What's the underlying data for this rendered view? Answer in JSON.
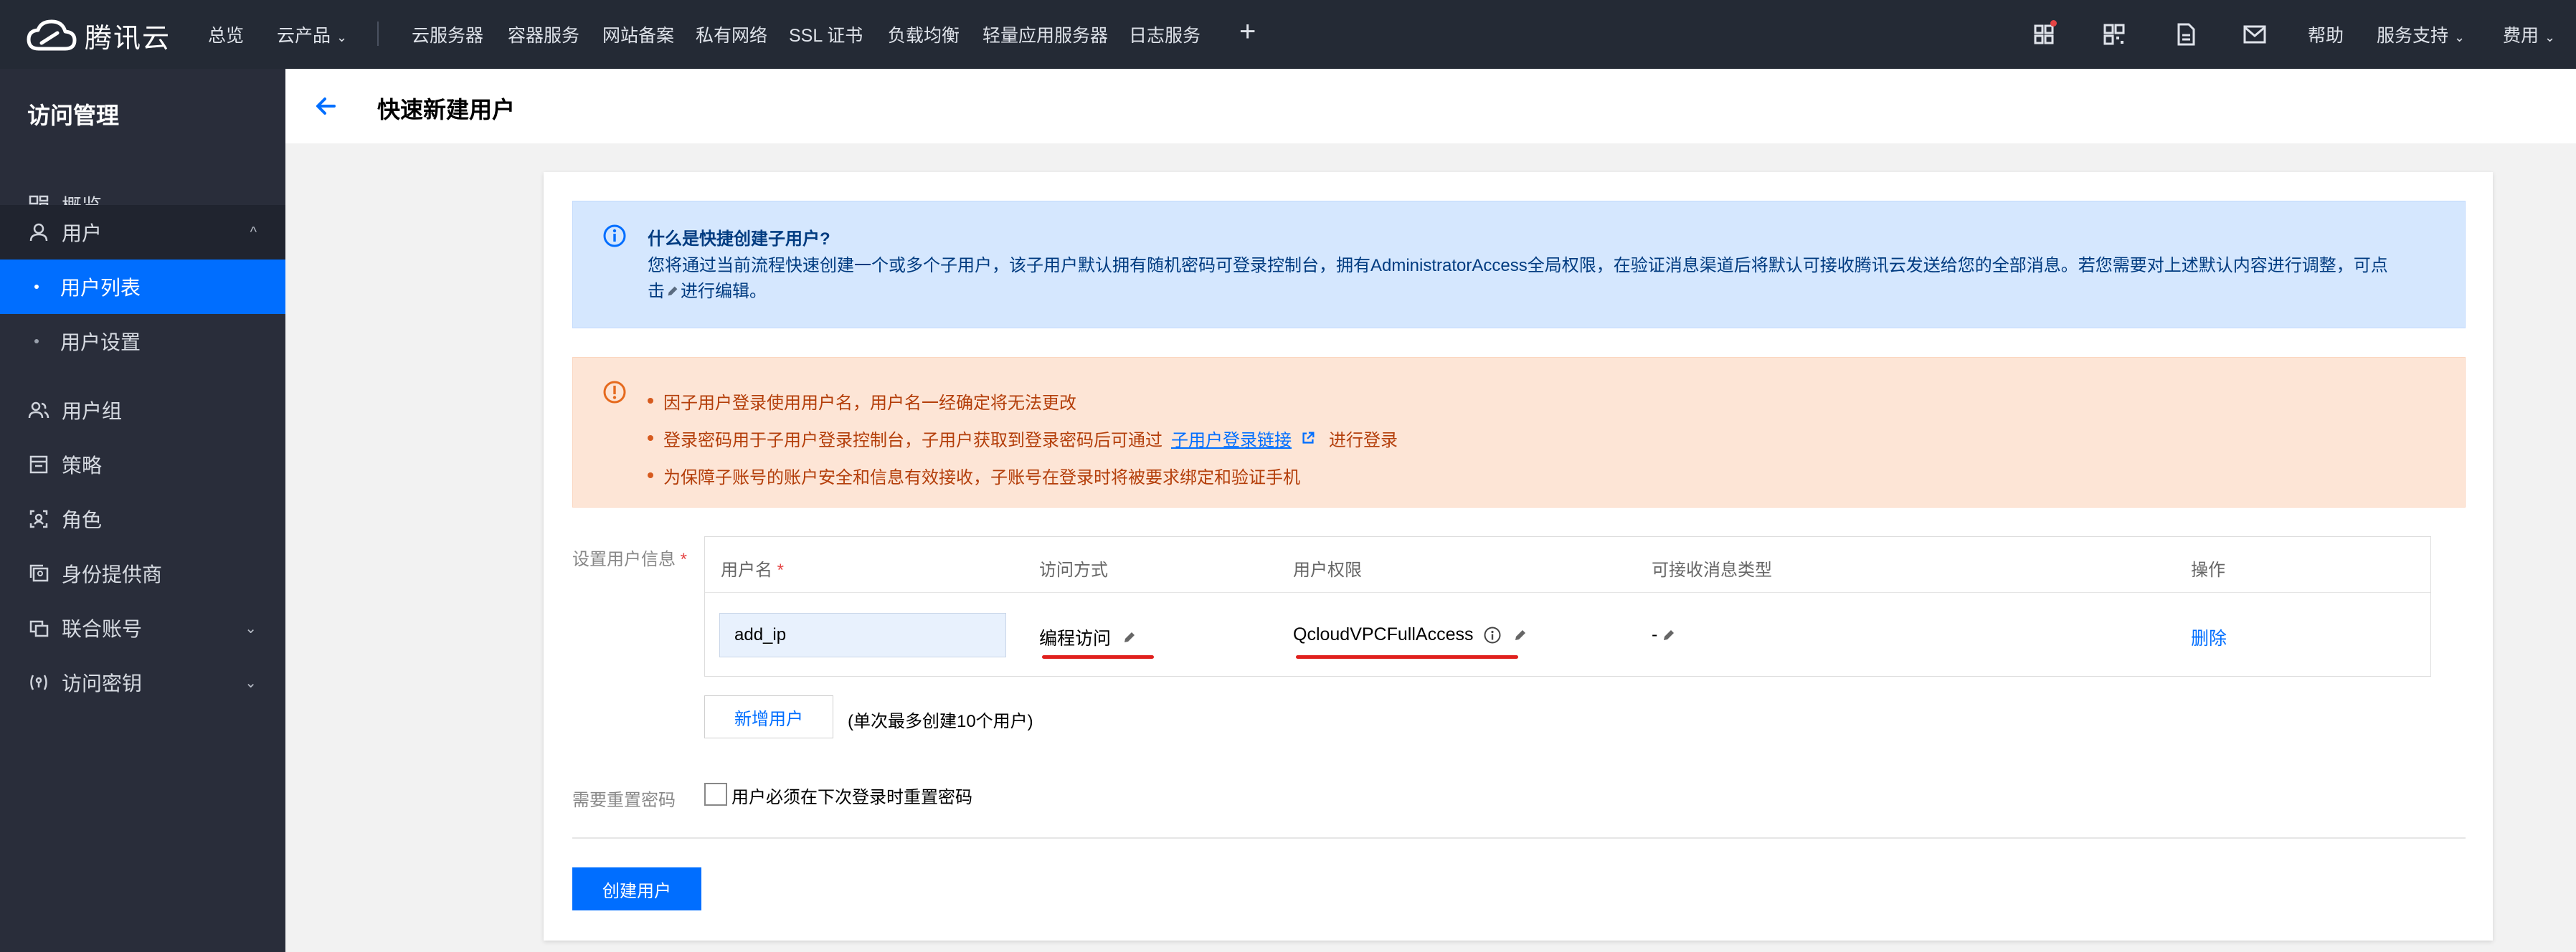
{
  "topnav": {
    "logo_text": "腾讯云",
    "items": [
      "总览",
      "云产品",
      "云服务器",
      "容器服务",
      "网站备案",
      "私有网络",
      "SSL 证书",
      "负载均衡",
      "轻量应用服务器",
      "日志服务"
    ],
    "plus": "+",
    "right_items": [
      "帮助",
      "服务支持",
      "费用"
    ],
    "icons": [
      "grid-apps-icon",
      "qrcode-icon",
      "document-icon",
      "mail-icon"
    ]
  },
  "sidebar": {
    "title": "访问管理",
    "items": [
      {
        "label": "概览",
        "icon": "overview-icon"
      },
      {
        "label": "用户",
        "icon": "user-icon"
      },
      {
        "label": "用户列表"
      },
      {
        "label": "用户设置"
      },
      {
        "label": "用户组",
        "icon": "user-group-icon"
      },
      {
        "label": "策略",
        "icon": "policy-icon"
      },
      {
        "label": "角色",
        "icon": "role-icon"
      },
      {
        "label": "身份提供商",
        "icon": "identity-provider-icon"
      },
      {
        "label": "联合账号",
        "icon": "federated-account-icon"
      },
      {
        "label": "访问密钥",
        "icon": "access-key-icon"
      }
    ]
  },
  "header": {
    "title": "快速新建用户"
  },
  "info": {
    "title": "什么是快捷创建子用户?",
    "text_before": "您将通过当前流程快速创建一个或多个子用户，该子用户默认拥有随机密码可登录控制台，拥有AdministratorAccess全局权限，在验证消息渠道后将默认可接收腾讯云发送给您的全部消息。若您需要对上述默认内容进行调整，可点击",
    "text_after": "进行编辑。"
  },
  "warning": {
    "line1": "因子用户登录使用用户名，用户名一经确定将无法更改",
    "line2_before": "登录密码用于子用户登录控制台，子用户获取到登录密码后可通过",
    "line2_link": "子用户登录链接",
    "line2_after": "进行登录",
    "line3": "为保障子账号的账户安全和信息有效接收，子账号在登录时将被要求绑定和验证手机"
  },
  "form": {
    "user_info_label": "设置用户信息",
    "table_headers": {
      "username": "用户名",
      "access": "访问方式",
      "permission": "用户权限",
      "message_types": "可接收消息类型",
      "action": "操作"
    },
    "row": {
      "username_value": "add_ip",
      "access": "编程访问",
      "permission": "QcloudVPCFullAccess",
      "message_types": "-",
      "action": "删除"
    },
    "add_user_label": "新增用户",
    "add_hint": "(单次最多创建10个用户)",
    "reset_label": "需要重置密码",
    "reset_checkbox_label": "用户必须在下次登录时重置密码",
    "create_label": "创建用户"
  },
  "colors": {
    "primary": "#006eff",
    "nav_bg": "#242a35",
    "sidebar_bg": "#292d3a",
    "info_bg": "#d5e7fe",
    "warning_bg": "#fde5d6",
    "annotation_red": "#e0201d"
  }
}
